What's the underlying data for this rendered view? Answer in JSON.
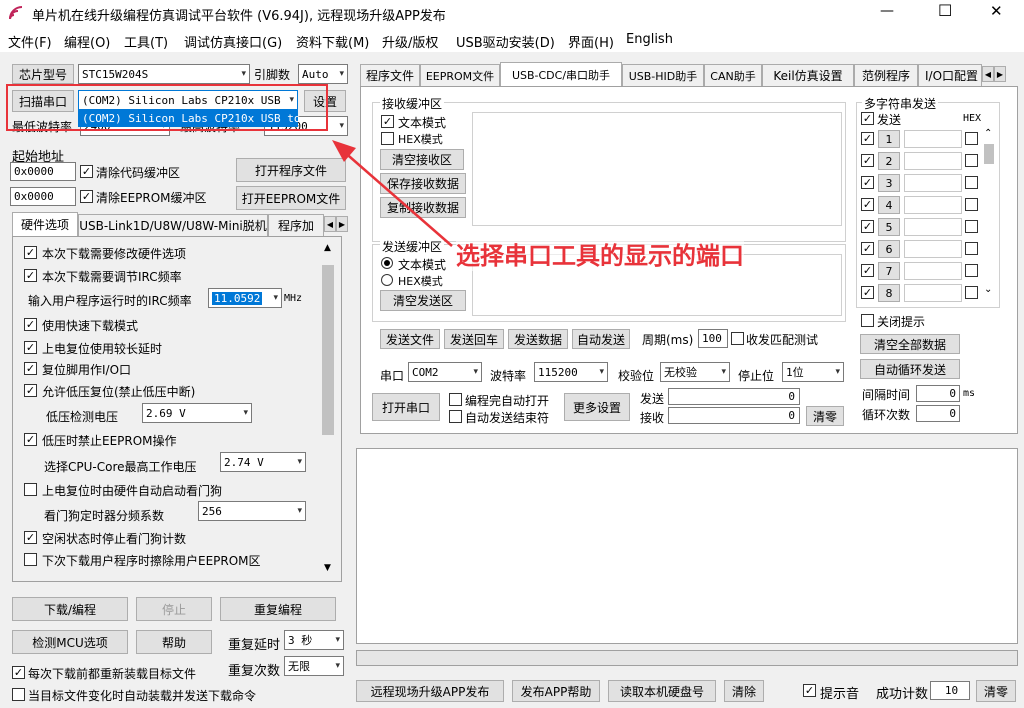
{
  "window": {
    "title": "单片机在线升级编程仿真调试平台软件 (V6.94J), 远程现场升级APP发布",
    "controls": [
      "—",
      "☐",
      "✕"
    ]
  },
  "menu": [
    "文件(F)",
    "编程(O)",
    "工具(T)",
    "调试仿真接口(G)",
    "资料下载(M)",
    "升级/版权",
    "USB驱动安装(D)",
    "界面(H)",
    "English"
  ],
  "left": {
    "chip_label": "芯片型号",
    "chip_value": "STC15W204S",
    "pins_label": "引脚数",
    "pins_value": "Auto",
    "scan_label": "扫描串口",
    "port_value": "(COM2) Silicon Labs CP210x USB",
    "port_option": "(COM2) Silicon Labs CP210x USB to",
    "settings_label": "设置",
    "baud_min_label": "最低波特率",
    "baud_min_value": "2400",
    "baud_max_label": "最高波特率",
    "baud_max_value": "115200",
    "start_addr_label": "起始地址",
    "addr1": "0x0000",
    "addr2": "0x0000",
    "clear_code": "清除代码缓冲区",
    "clear_eeprom": "清除EEPROM缓冲区",
    "open_prog": "打开程序文件",
    "open_eeprom": "打开EEPROM文件",
    "tabs": [
      "硬件选项",
      "USB-Link1D/U8W/U8W-Mini脱机",
      "程序加"
    ],
    "options": [
      {
        "label": "本次下载需要修改硬件选项",
        "checked": true
      },
      {
        "label": "本次下载需要调节IRC频率",
        "checked": true
      },
      {
        "label": "使用快速下载模式",
        "checked": true
      },
      {
        "label": "上电复位使用较长延时",
        "checked": true
      },
      {
        "label": "复位脚用作I/O口",
        "checked": true
      },
      {
        "label": "允许低压复位(禁止低压中断)",
        "checked": true
      },
      {
        "label": "低压时禁止EEPROM操作",
        "checked": true
      },
      {
        "label": "上电复位时由硬件自动启动看门狗",
        "checked": false
      },
      {
        "label": "空闲状态时停止看门狗计数",
        "checked": true
      },
      {
        "label": "下次下载用户程序时擦除用户EEPROM区",
        "checked": false
      }
    ],
    "irc_label": "输入用户程序运行时的IRC频率",
    "irc_value": "11.0592",
    "irc_unit": "MHz",
    "lvd_label": "低压检测电压",
    "lvd_value": "2.69 V",
    "cpu_label": "选择CPU-Core最高工作电压",
    "cpu_value": "2.74 V",
    "wdt_label": "看门狗定时器分频系数",
    "wdt_value": "256",
    "download": "下载/编程",
    "stop": "停止",
    "reprog": "重复编程",
    "detect": "检测MCU选项",
    "help": "帮助",
    "repeat_delay_label": "重复延时",
    "repeat_delay_value": "3 秒",
    "repeat_count_label": "重复次数",
    "repeat_count_value": "无限",
    "reload": "每次下载前都重新装载目标文件",
    "auto_reload": "当目标文件变化时自动装载并发送下载命令"
  },
  "right": {
    "tabs": [
      "程序文件",
      "EEPROM文件",
      "USB-CDC/串口助手",
      "USB-HID助手",
      "CAN助手",
      "Keil仿真设置",
      "范例程序",
      "I/O口配置"
    ],
    "recv_title": "接收缓冲区",
    "text_mode": "文本模式",
    "hex_mode": "HEX模式",
    "clear_recv": "清空接收区",
    "save_recv": "保存接收数据",
    "copy_recv": "复制接收数据",
    "send_title": "发送缓冲区",
    "send_text_mode": "文本模式",
    "send_hex_mode": "HEX模式",
    "clear_send": "清空发送区",
    "send_file": "发送文件",
    "send_return": "发送回车",
    "send_data": "发送数据",
    "auto_send": "自动发送",
    "period_label": "周期(ms)",
    "period_value": "100",
    "match_test": "收发匹配测试",
    "port_label": "串口",
    "port_value": "COM2",
    "baud_label": "波特率",
    "baud_value": "115200",
    "parity_label": "校验位",
    "parity_value": "无校验",
    "stop_label": "停止位",
    "stop_value": "1位",
    "open_port": "打开串口",
    "auto_open": "编程完自动打开",
    "auto_end": "自动发送结束符",
    "more_settings": "更多设置",
    "sent_label": "发送",
    "sent_value": "0",
    "recv_label": "接收",
    "recv_value": "0",
    "clear_counts": "清零",
    "multi_title": "多字符串发送",
    "multi_send": "发送",
    "multi_hex": "HEX",
    "multi_rows": [
      "1",
      "2",
      "3",
      "4",
      "5",
      "6",
      "7",
      "8"
    ],
    "close_tip": "关闭提示",
    "clear_all": "清空全部数据",
    "auto_loop": "自动循环发送",
    "interval_label": "间隔时间",
    "interval_value": "0",
    "interval_unit": "ms",
    "loop_label": "循环次数",
    "loop_value": "0"
  },
  "annotation": {
    "text": "选择串口工具的显示的端口",
    "color": "#e8333a"
  },
  "bottom": {
    "remote": "远程现场升级APP发布",
    "publish_help": "发布APP帮助",
    "read_disk": "读取本机硬盘号",
    "clear": "清除",
    "sound": "提示音",
    "success_label": "成功计数",
    "success_value": "10",
    "reset": "清零"
  }
}
